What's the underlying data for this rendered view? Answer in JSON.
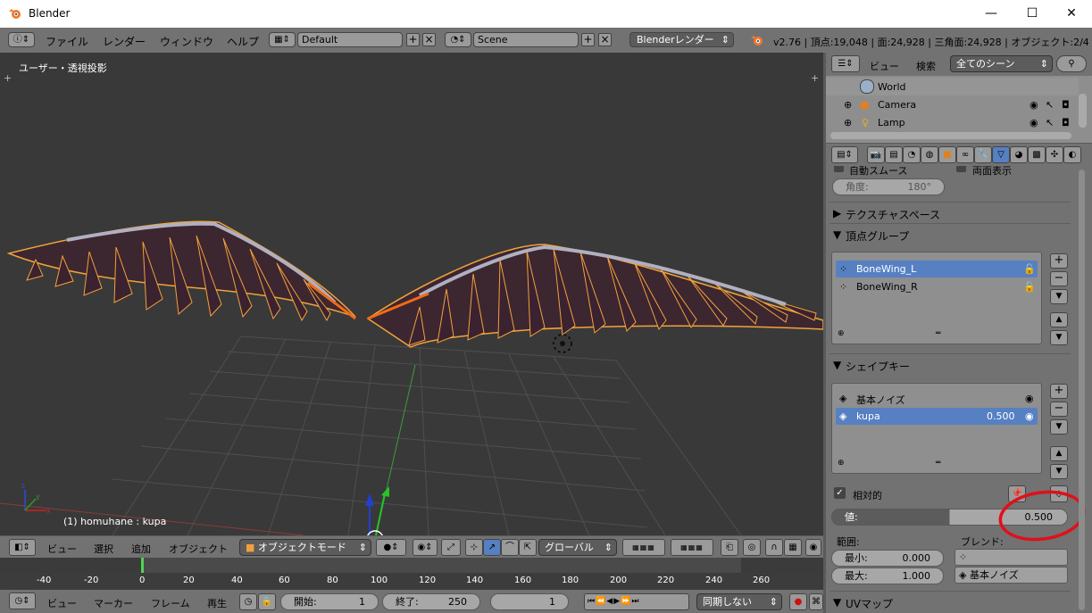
{
  "window": {
    "title": "Blender",
    "minimize": "—",
    "maximize": "☐",
    "close": "✕"
  },
  "info_header": {
    "menus": [
      "ファイル",
      "レンダー",
      "ウィンドウ",
      "ヘルプ"
    ],
    "layout": "Default",
    "scene": "Scene",
    "engine": "Blenderレンダー",
    "stats": "v2.76 | 頂点:19,048 | 面:24,928 | 三角面:24,928 | オブジェクト:2/4 | >"
  },
  "viewport": {
    "view_label": "ユーザー・透視投影",
    "object_info": "(1) homuhane : kupa",
    "corner_plus": "+"
  },
  "viewport_header": {
    "view": "ビュー",
    "select": "選択",
    "add": "追加",
    "object": "オブジェクト",
    "mode": "オブジェクトモード",
    "orientation": "グローバル"
  },
  "timeline": {
    "ticks": [
      "-40",
      "-20",
      "0",
      "20",
      "40",
      "60",
      "80",
      "100",
      "120",
      "140",
      "160",
      "180",
      "200",
      "220",
      "240",
      "260"
    ],
    "view": "ビュー",
    "marker": "マーカー",
    "frame": "フレーム",
    "playback": "再生",
    "start_label": "開始:",
    "start_value": "1",
    "end_label": "終了:",
    "end_value": "250",
    "current": "1",
    "sync": "同期しない"
  },
  "outliner": {
    "view": "ビュー",
    "search": "検索",
    "scenes": "全てのシーン",
    "items": [
      "World",
      "Camera",
      "Lamp"
    ]
  },
  "properties": {
    "autosmooth": "自動スムース",
    "double_sided": "両面表示",
    "angle_label": "角度:",
    "angle_value": "180°",
    "texture_space": "テクスチャスペース",
    "vertex_groups": "頂点グループ",
    "vgroups": [
      "BoneWing_L",
      "BoneWing_R"
    ],
    "shape_keys": "シェイプキー",
    "skeys": [
      {
        "name": "基本ノイズ",
        "value": ""
      },
      {
        "name": "kupa",
        "value": "0.500"
      }
    ],
    "relative": "相対的",
    "value_label": "値:",
    "value": "0.500",
    "range_label": "範囲:",
    "blend_label": "ブレンド:",
    "min_label": "最小:",
    "min_value": "0.000",
    "max_label": "最大:",
    "max_value": "1.000",
    "blend_ref": "基本ノイズ",
    "uv_maps": "UVマップ"
  },
  "colors": {
    "selection": "#5680c2",
    "wing_outline": "#f2a23a",
    "highlight_circle": "#e0101a"
  }
}
